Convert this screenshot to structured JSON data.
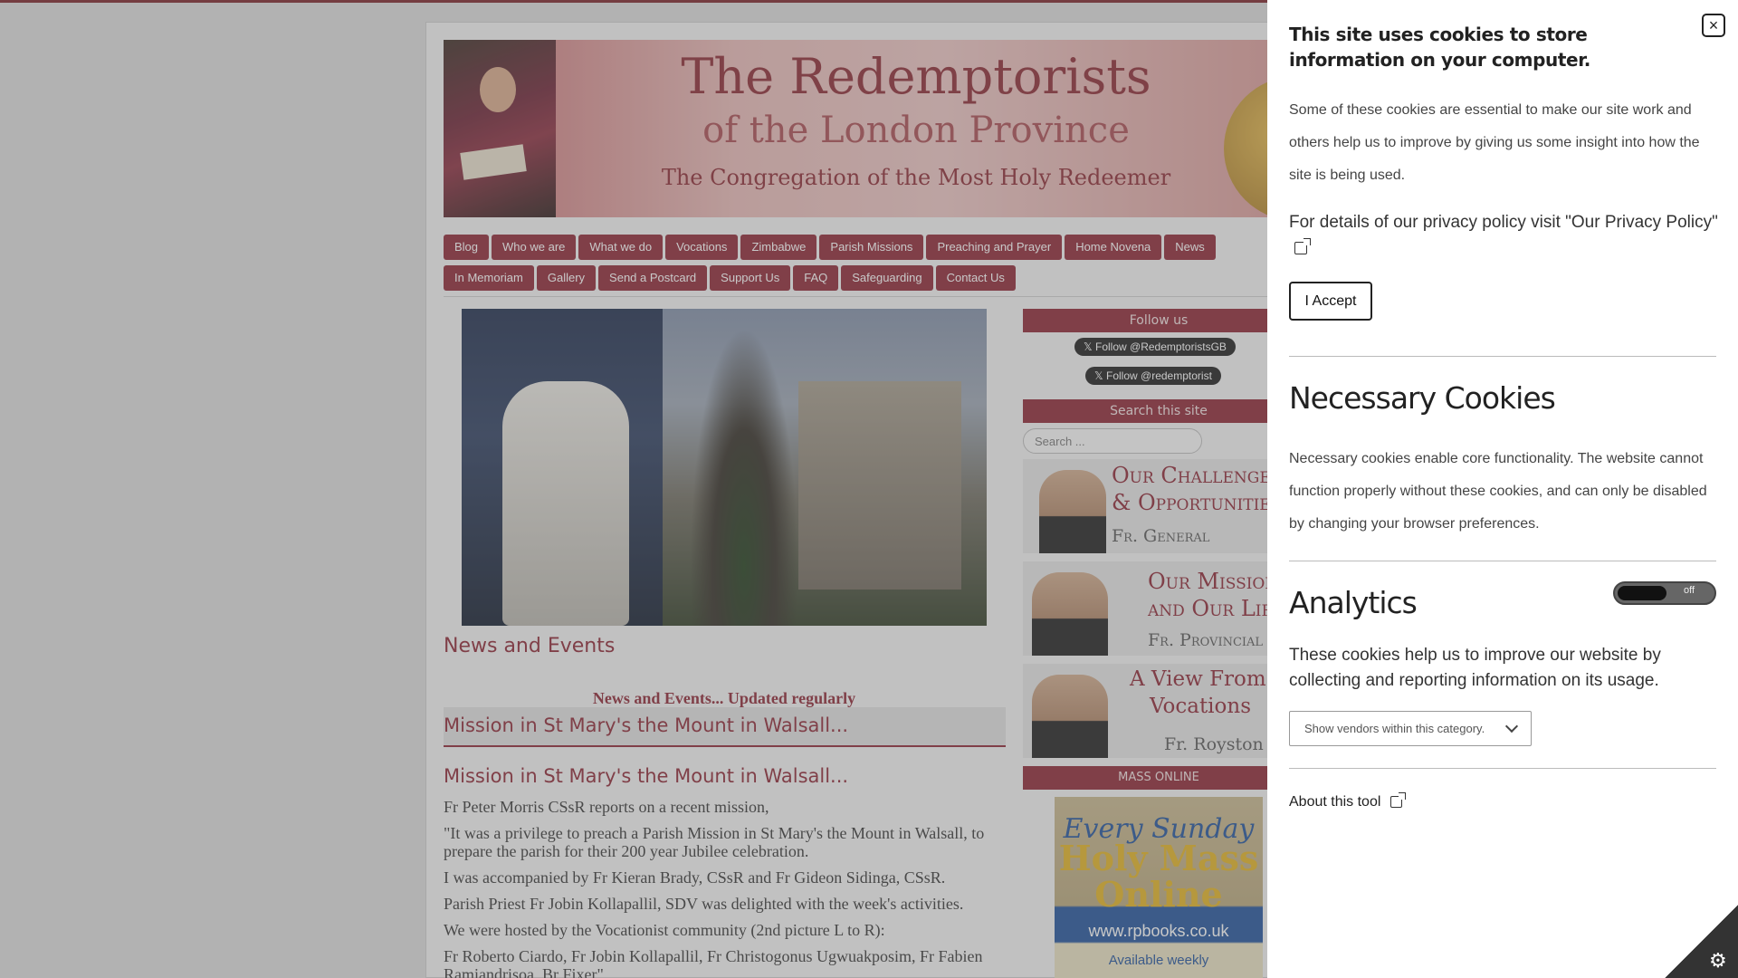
{
  "banner": {
    "title": "The Redemptorists",
    "subtitle": "of the London Province",
    "tagline": "The Congregation of the Most Holy Redeemer"
  },
  "nav": {
    "row1": [
      "Blog",
      "Who we are",
      "What we do",
      "Vocations",
      "Zimbabwe",
      "Parish Missions",
      "Preaching and Prayer",
      "Home Novena",
      "News"
    ],
    "row2": [
      "In Memoriam",
      "Gallery",
      "Send a Postcard",
      "Support Us",
      "FAQ",
      "Safeguarding",
      "Contact Us"
    ]
  },
  "main": {
    "news_heading": "News and Events",
    "news_sub": "News and Events... Updated regularly",
    "article_bar_title": "Mission in St Mary's the Mount in Walsall...",
    "article_title": "Mission in St Mary's the Mount in Walsall...",
    "paragraphs": [
      "Fr Peter Morris CSsR reports on a recent mission,",
      "\"It was a privilege to preach a Parish Mission in St Mary's the Mount in Walsall, to prepare the parish for their 200 year Jubilee celebration.",
      "I was accompanied by Fr Kieran Brady, CSsR and Fr Gideon Sidinga, CSsR.",
      "Parish Priest Fr Jobin Kollapallil, SDV was delighted with the week's activities.",
      "We were hosted by the Vocationist community (2nd picture L to R):",
      "Fr Roberto Ciardo, Fr Jobin Kollapallil, Fr Christogonus Ugwuakposim, Fr Fabien Ramiandrisoa, Br Fixer\""
    ]
  },
  "sidebar": {
    "follow_heading": "Follow us",
    "twitter1": "Follow @RedemptoristsGB",
    "twitter2": "Follow @redemptorist",
    "search_heading": "Search this site",
    "search_placeholder": "Search ...",
    "promo1_line1": "Our Challenges",
    "promo1_line2": "& Opportunities",
    "promo1_name": "Fr. General",
    "promo2_line1": "Our Mission",
    "promo2_line2": "and Our Life",
    "promo2_name": "Fr. Provincial",
    "promo3_line1": "A View From",
    "promo3_line2": "Vocations",
    "promo3_name": "Fr. Royston",
    "mass_heading": "MASS ONLINE",
    "mass_line1": "Every Sunday",
    "mass_line2a": "Holy Mass",
    "mass_line2b": "Online",
    "mass_url": "www.rpbooks.co.uk",
    "mass_avail": "Available weekly"
  },
  "cookie_panel": {
    "intro_title": "This site uses cookies to store information on your computer.",
    "intro_text": "Some of these cookies are essential to make our site work and others help us to improve by giving us some insight into how the site is being used.",
    "privacy_text": "For details of our privacy policy visit \"Our Privacy Policy\"",
    "accept_label": "I Accept",
    "necessary_title": "Necessary Cookies",
    "necessary_text": "Necessary cookies enable core functionality. The website cannot function properly without these cookies, and can only be disabled by changing your browser preferences.",
    "analytics_title": "Analytics",
    "analytics_toggle": "off",
    "analytics_text": "These cookies help us to improve our website by collecting and reporting information on its usage.",
    "vendors_label": "Show vendors within this category.",
    "about_label": "About this tool",
    "close_icon": "×"
  },
  "icons": {
    "close": "close-icon",
    "external": "external-link-icon",
    "chevron": "chevron-down-icon",
    "gear": "gear-icon"
  },
  "colors": {
    "brand": "#8b2331",
    "panel_bg": "#ffffff"
  }
}
